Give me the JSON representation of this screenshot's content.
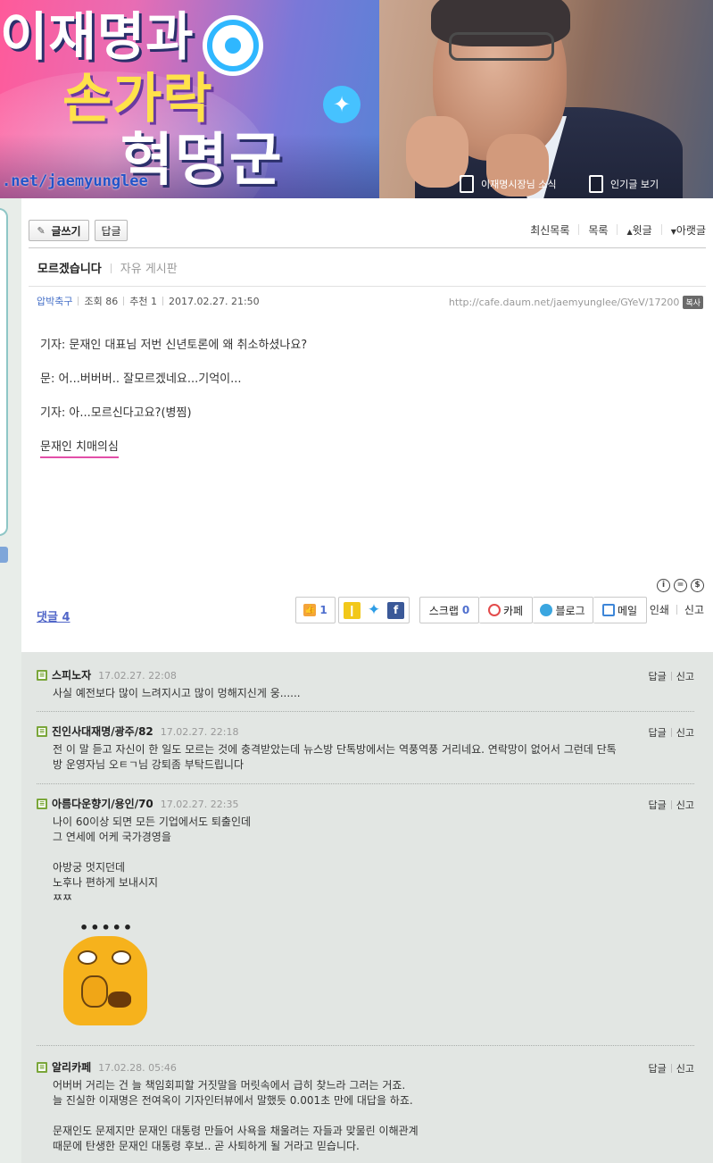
{
  "banner": {
    "title_line1": "이재명과",
    "title_line2": "손가락",
    "title_line3": "혁명군",
    "url_text": ".net/jaemyunglee",
    "link_news": "이재명시장님 소식",
    "link_popular": "인기글 보기"
  },
  "toolbar": {
    "write_label": "글쓰기",
    "reply_label": "답글",
    "recent_label": "최신목록",
    "list_label": "목록",
    "prev_label": "윗글",
    "next_label": "아랫글"
  },
  "post": {
    "title": "모르겠습니다",
    "board": "자유 게시판",
    "author": "압박축구",
    "views": "조회 86",
    "recommends": "추천 1",
    "datetime": "2017.02.27. 21:50",
    "url": "http://cafe.daum.net/jaemyunglee/GYeV/17200",
    "copy_label": "복사",
    "lines": [
      "기자: 문재인 대표님 저번 신년토론에 왜 취소하셨나요?",
      "문: 어...버버버.. 잘모르겠네요...기억이...",
      "기자: 아...모르신다고요?(병찜)",
      "문재인 치매의심"
    ]
  },
  "cc": [
    "i",
    "=",
    "$"
  ],
  "actions": {
    "reply_count_label": "댓글 4",
    "like_count": "1",
    "scrap_label": "스크랩",
    "scrap_count": "0",
    "cafe_label": "카페",
    "blog_label": "블로그",
    "mail_label": "메일",
    "print_label": "인쇄",
    "report_label": "신고"
  },
  "comments": [
    {
      "name": "스피노자",
      "date": "17.02.27. 22:08",
      "reply": "답글",
      "report": "신고",
      "lines": [
        "사실 예전보다 많이 느려지시고 많이 멍해지신게 웅......"
      ]
    },
    {
      "name": "진인사대재명/광주/82",
      "date": "17.02.27. 22:18",
      "reply": "답글",
      "report": "신고",
      "lines": [
        "전 이 말 듣고 자신이 한 일도 모르는 것에 충격받았는데 뉴스방 단톡방에서는 역풍역풍 거리네요. 연락망이 없어서 그런데 단톡",
        "방 운영자님 오ㅌㄱ님 강퇴좀 부탁드립니다"
      ]
    },
    {
      "name": "아름다운향기/용인/70",
      "date": "17.02.27. 22:35",
      "reply": "답글",
      "report": "신고",
      "lines": [
        "나이 60이상 되면 모든 기업에서도 퇴출인데",
        "그 연세에 어케 국가경영을",
        "",
        "아방궁 멋지던데",
        "노후나 편하게 보내시지",
        "ㅉㅉ"
      ]
    },
    {
      "name": "알리카페",
      "date": "17.02.28. 05:46",
      "reply": "답글",
      "report": "신고",
      "lines": [
        "어버버 거리는 건 늘 책임회피할 거짓말을 머릿속에서 급히 찾느라 그러는 거죠.",
        "늘 진실한 이재명은 전여옥이 기자인터뷰에서 말했듯 0.001초 만에 대답을 하죠.",
        "",
        "문재인도 문제지만 문재인 대통령 만들어 사욕을 채울려는 자들과 맞물린 이해관계",
        "때문에 탄생한 문재인 대통령 후보.. 곧 사퇴하게 될 거라고 믿습니다."
      ]
    }
  ],
  "colors": {
    "author_link": "#4670c8",
    "reply_count": "#5166c8",
    "highlight_underline": "#e24ea8",
    "comment_bg": "#e2e6e3"
  }
}
